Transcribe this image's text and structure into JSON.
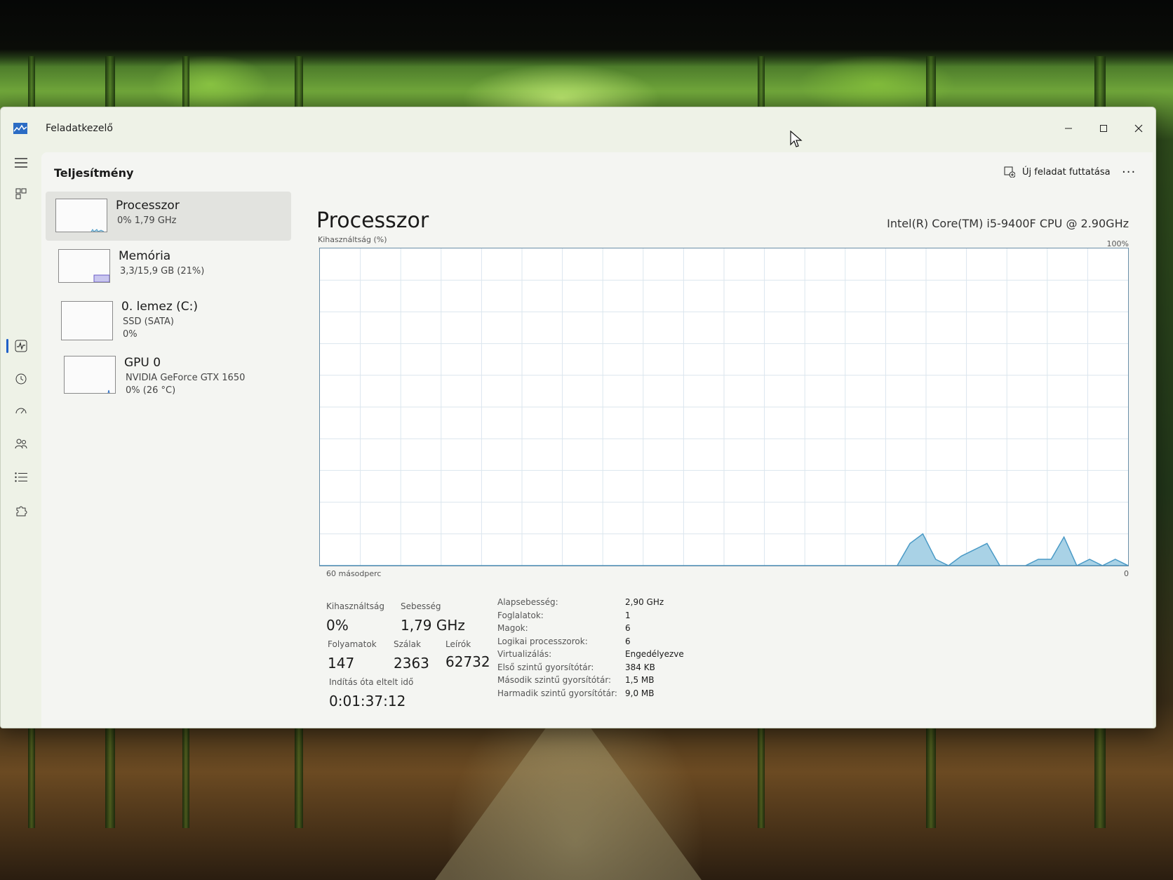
{
  "window": {
    "title": "Feladatkezelő"
  },
  "header": {
    "page_title": "Teljesítmény",
    "new_task_label": "Új feladat futtatása"
  },
  "resources": [
    {
      "name": "Processzor",
      "sub1": "0% 1,79 GHz",
      "sub2": ""
    },
    {
      "name": "Memória",
      "sub1": "3,3/15,9 GB (21%)",
      "sub2": ""
    },
    {
      "name": "0. lemez (C:)",
      "sub1": "SSD (SATA)",
      "sub2": "0%"
    },
    {
      "name": "GPU 0",
      "sub1": "NVIDIA GeForce GTX 1650",
      "sub2": "0% (26 °C)"
    }
  ],
  "detail": {
    "title": "Processzor",
    "model": "Intel(R) Core(TM) i5-9400F CPU @ 2.90GHz",
    "graph_label": "Kihasználtság (%)",
    "graph_max": "100%",
    "graph_min": "0",
    "time_label": "60 másodperc"
  },
  "stats": {
    "utilization_label": "Kihasználtság",
    "utilization_value": "0%",
    "speed_label": "Sebesség",
    "speed_value": "1,79 GHz",
    "processes_label": "Folyamatok",
    "processes_value": "147",
    "threads_label": "Szálak",
    "threads_value": "2363",
    "handles_label": "Leírók",
    "handles_value": "62732",
    "uptime_label": "Indítás óta eltelt idő",
    "uptime_value": "0:01:37:12"
  },
  "specs": [
    {
      "key": "Alapsebesség:",
      "value": "2,90 GHz"
    },
    {
      "key": "Foglalatok:",
      "value": "1"
    },
    {
      "key": "Magok:",
      "value": "6"
    },
    {
      "key": "Logikai processzorok:",
      "value": "6"
    },
    {
      "key": "Virtualizálás:",
      "value": "Engedélyezve"
    },
    {
      "key": "Első szintű gyorsítótár:",
      "value": "384 KB"
    },
    {
      "key": "Második szintű gyorsítótár:",
      "value": "1,5 MB"
    },
    {
      "key": "Harmadik szintű gyorsítótár:",
      "value": "9,0 MB"
    }
  ],
  "chart_data": {
    "type": "area",
    "ylim": [
      0,
      100
    ],
    "x_span_seconds": 60,
    "values": [
      0,
      0,
      0,
      0,
      0,
      0,
      0,
      0,
      0,
      0,
      0,
      0,
      0,
      0,
      0,
      0,
      0,
      0,
      0,
      0,
      0,
      0,
      0,
      0,
      0,
      0,
      0,
      0,
      0,
      0,
      0,
      0,
      0,
      0,
      0,
      0,
      0,
      0,
      0,
      0,
      0,
      0,
      0,
      0,
      0,
      0,
      7,
      10,
      2,
      0,
      3,
      5,
      7,
      0,
      0,
      0,
      2,
      2,
      9,
      0,
      2,
      0,
      2,
      0
    ]
  },
  "colors": {
    "accent": "#1f5fc7",
    "graph_border": "#6a8ea8",
    "graph_fill": "#a9d2e6",
    "graph_line": "#4a9ac6"
  }
}
